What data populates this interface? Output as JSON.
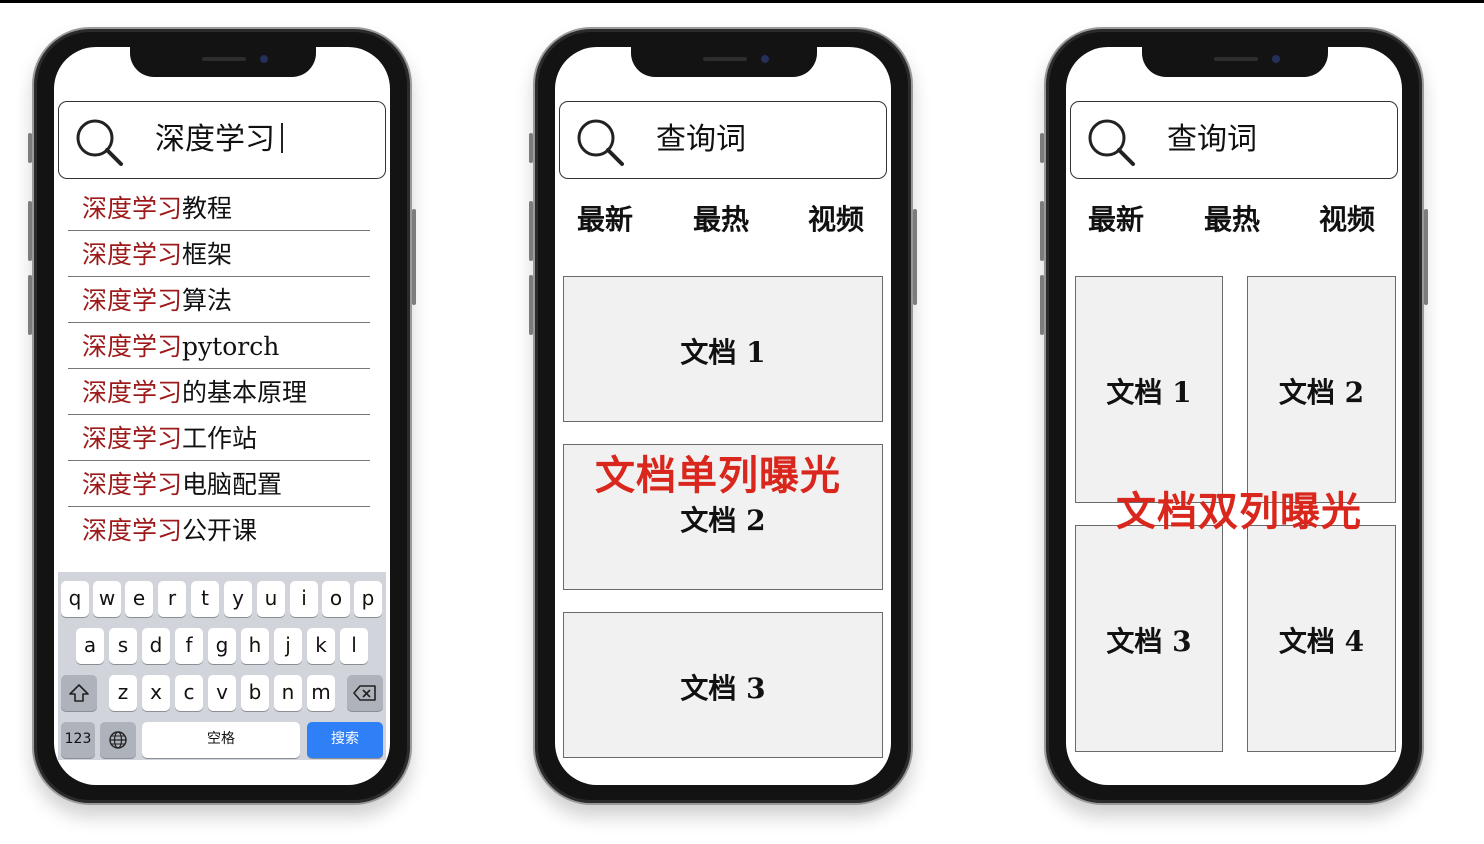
{
  "phones": [
    {
      "search_text": "深度学习",
      "suggestions": [
        {
          "highlight": "深度学习",
          "rest": "教程"
        },
        {
          "highlight": "深度学习",
          "rest": "框架"
        },
        {
          "highlight": "深度学习",
          "rest": "算法"
        },
        {
          "highlight": "深度学习",
          "rest": "pytorch"
        },
        {
          "highlight": "深度学习",
          "rest": "的基本原理"
        },
        {
          "highlight": "深度学习",
          "rest": "工作站"
        },
        {
          "highlight": "深度学习",
          "rest": "电脑配置"
        },
        {
          "highlight": "深度学习",
          "rest": "公开课"
        }
      ],
      "keyboard": {
        "row1": [
          "q",
          "w",
          "e",
          "r",
          "t",
          "y",
          "u",
          "i",
          "o",
          "p"
        ],
        "row2": [
          "a",
          "s",
          "d",
          "f",
          "g",
          "h",
          "j",
          "k",
          "l"
        ],
        "row3": [
          "z",
          "x",
          "c",
          "v",
          "b",
          "n",
          "m"
        ],
        "numbers_key": "123",
        "space_key": "空格",
        "search_key": "搜索"
      }
    },
    {
      "search_text": "查询词",
      "tabs": [
        "最新",
        "最热",
        "视频"
      ],
      "docs": [
        "文档 1",
        "文档 2",
        "文档 3"
      ],
      "overlay_label": "文档单列曝光"
    },
    {
      "search_text": "查询词",
      "tabs": [
        "最新",
        "最热",
        "视频"
      ],
      "docs": [
        "文档 1",
        "文档 2",
        "文档 3",
        "文档 4"
      ],
      "overlay_label": "文档双列曝光"
    }
  ],
  "colors": {
    "highlight": "#9e1a1a",
    "overlay_label": "#d9271d",
    "search_key": "#2f7ff6",
    "card_fill": "#f1f1f1"
  },
  "icons": [
    "search-icon",
    "shift-icon",
    "backspace-icon",
    "globe-icon"
  ]
}
